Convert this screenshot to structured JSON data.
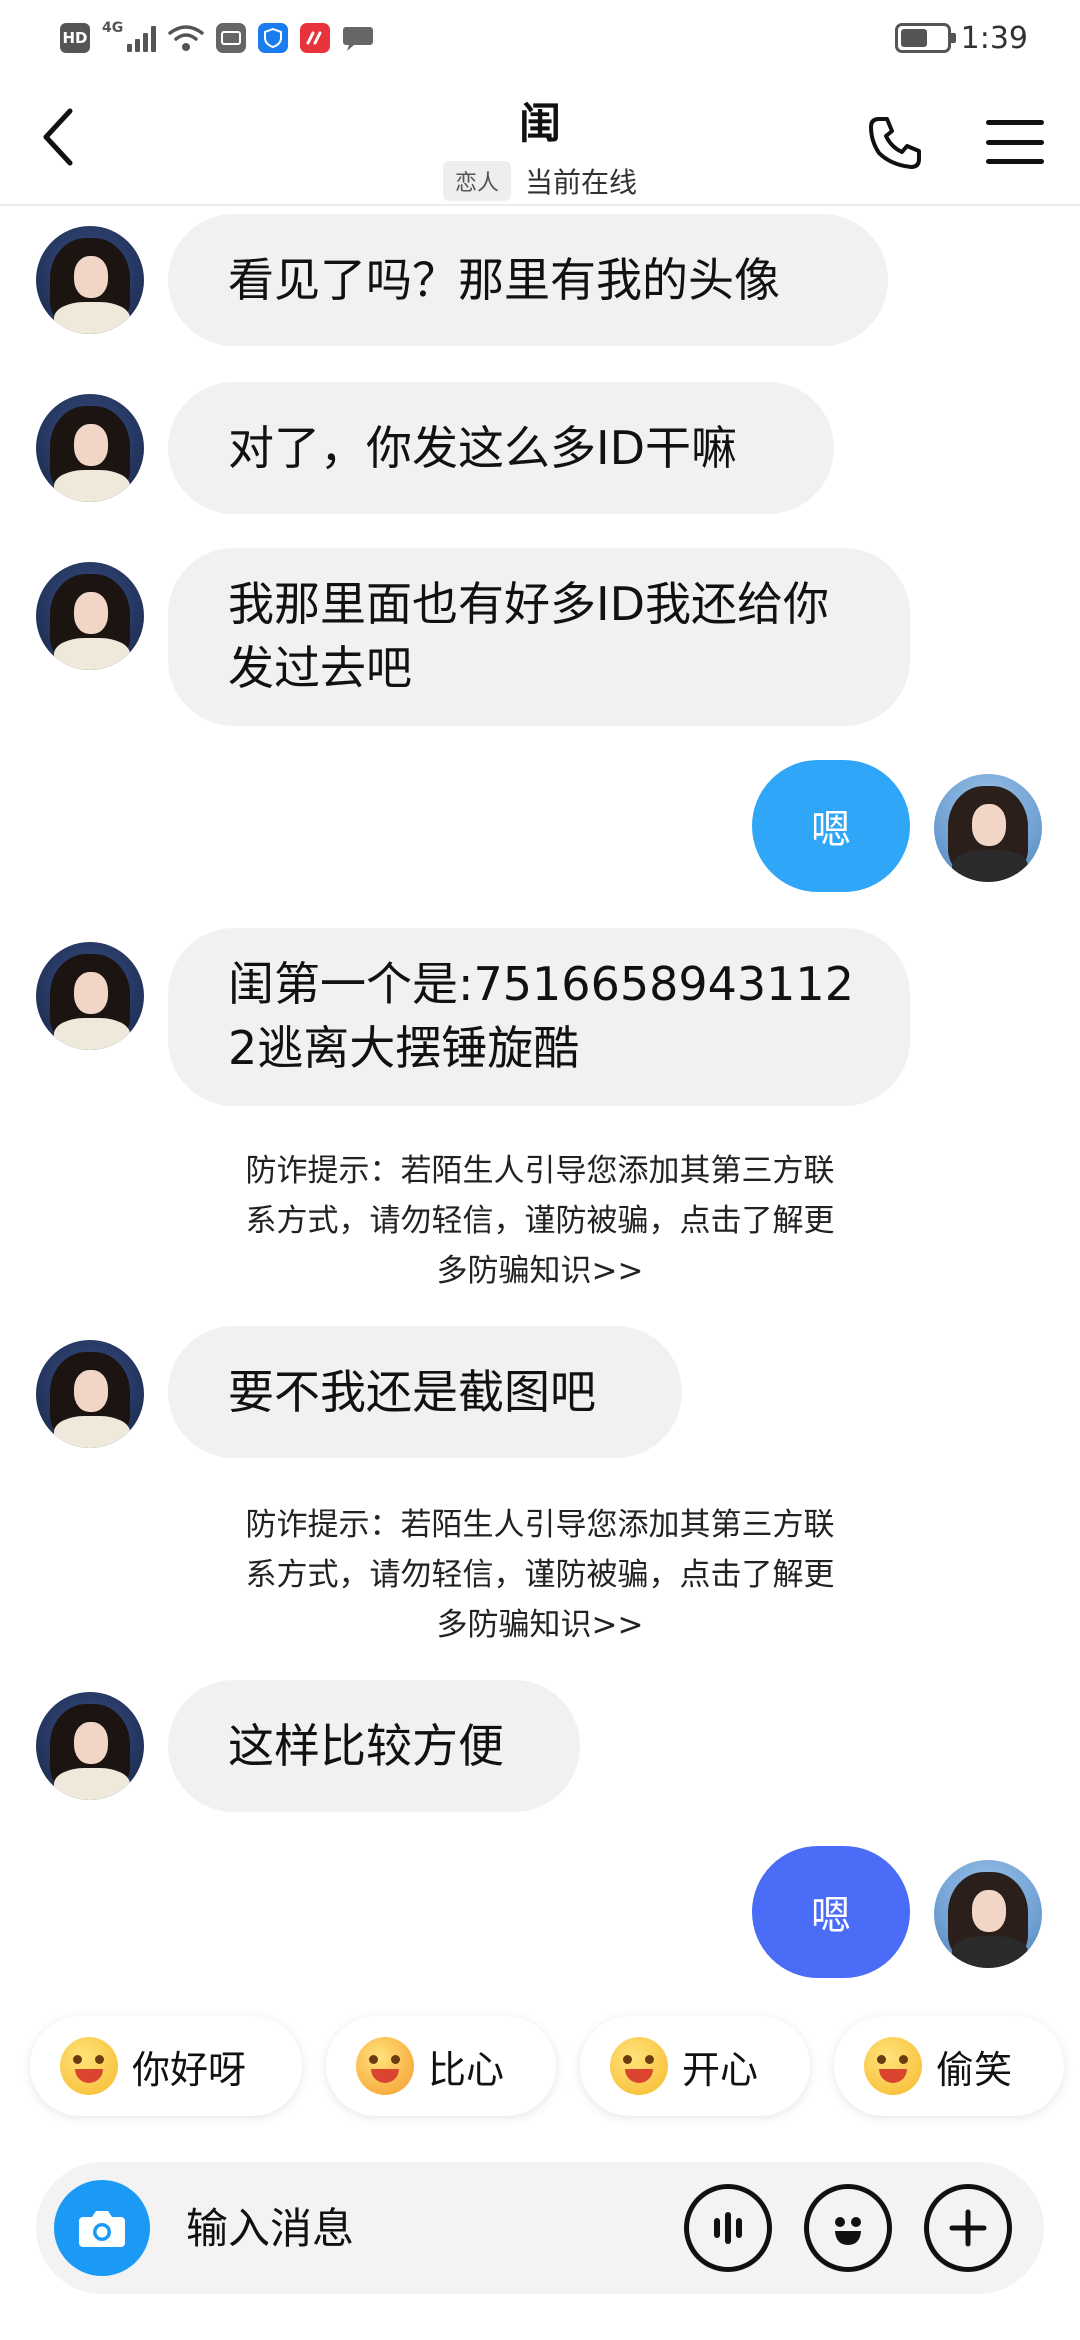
{
  "status_bar": {
    "hd_label": "HD",
    "network_label": "4G",
    "battery_level": 0.6,
    "time": "1:39"
  },
  "header": {
    "contact_name": "闺",
    "relation_tag": "恋人",
    "status_text": "当前在线"
  },
  "messages": [
    {
      "side": "in",
      "text": "看见了吗？那里有我的头像"
    },
    {
      "side": "in",
      "text": "对了，你发这么多ID干嘛"
    },
    {
      "side": "in",
      "text": "我那里面也有好多ID我还给你发过去吧"
    },
    {
      "side": "out",
      "text": "嗯",
      "color": "#2fa6f7"
    },
    {
      "side": "in",
      "text": "闺第一个是:75166589431122逃离大摆锤旋酷"
    },
    {
      "side": "notice",
      "text": "防诈提示：若陌生人引导您添加其第三方联系方式，请勿轻信，谨防被骗，点击了解更多防骗知识>>"
    },
    {
      "side": "in",
      "text": "要不我还是截图吧"
    },
    {
      "side": "notice",
      "text": "防诈提示：若陌生人引导您添加其第三方联系方式，请勿轻信，谨防被骗，点击了解更多防骗知识>>"
    },
    {
      "side": "in",
      "text": "这样比较方便"
    },
    {
      "side": "out",
      "text": "嗯",
      "color": "#4a6cf7"
    }
  ],
  "quick_replies": [
    {
      "label": "你好呀",
      "icon": "grinning-emoji-icon"
    },
    {
      "label": "比心",
      "icon": "heart-hands-emoji-icon"
    },
    {
      "label": "开心",
      "icon": "laughing-emoji-icon"
    },
    {
      "label": "偷笑",
      "icon": "smirk-emoji-icon"
    }
  ],
  "input": {
    "placeholder": "输入消息",
    "camera_icon": "camera-icon",
    "voice_icon": "voice-icon",
    "emoji_icon": "emoji-icon",
    "plus_icon": "plus-icon"
  },
  "colors": {
    "accent_blue": "#1b9af5",
    "incoming_bubble": "#f1f1f1"
  }
}
